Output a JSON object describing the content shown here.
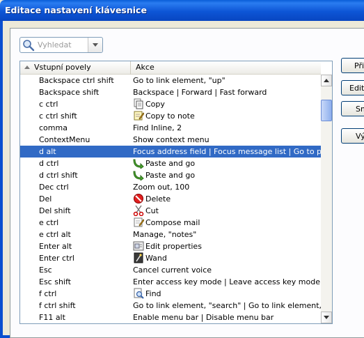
{
  "window": {
    "title": "Editace nastavení klávesnice"
  },
  "search": {
    "placeholder": "Vyhledat"
  },
  "table": {
    "columns": [
      "Vstupní povely",
      "Akce"
    ],
    "rows": [
      {
        "keys": "Backspace ctrl shift",
        "action": "Go to link element, \"up\"",
        "icon": ""
      },
      {
        "keys": "Backspace shift",
        "action": "Backspace | Forward | Fast forward",
        "icon": ""
      },
      {
        "keys": "c ctrl",
        "action": "Copy",
        "icon": "copy-icon"
      },
      {
        "keys": "c ctrl shift",
        "action": "Copy to note",
        "icon": "note-icon"
      },
      {
        "keys": "comma",
        "action": "Find Inline, 2",
        "icon": ""
      },
      {
        "keys": "ContextMenu",
        "action": "Show context menu",
        "icon": ""
      },
      {
        "keys": "d alt",
        "action": "Focus address field | Focus message list | Go to page",
        "icon": "",
        "selected": true
      },
      {
        "keys": "d ctrl",
        "action": "Paste and go",
        "icon": "paste-go-icon"
      },
      {
        "keys": "d ctrl shift",
        "action": "Paste and go",
        "icon": "paste-go-icon"
      },
      {
        "keys": "Dec ctrl",
        "action": "Zoom out, 100",
        "icon": ""
      },
      {
        "keys": "Del",
        "action": "Delete",
        "icon": "delete-icon"
      },
      {
        "keys": "Del shift",
        "action": "Cut",
        "icon": "scissors-icon"
      },
      {
        "keys": "e ctrl",
        "action": "Compose mail",
        "icon": "compose-icon"
      },
      {
        "keys": "e ctrl alt",
        "action": "Manage, \"notes\"",
        "icon": ""
      },
      {
        "keys": "Enter alt",
        "action": "Edit properties",
        "icon": "properties-icon"
      },
      {
        "keys": "Enter ctrl",
        "action": "Wand",
        "icon": "wand-icon"
      },
      {
        "keys": "Esc",
        "action": "Cancel current voice",
        "icon": ""
      },
      {
        "keys": "Esc shift",
        "action": "Enter access key mode | Leave access key mode",
        "icon": ""
      },
      {
        "keys": "f ctrl",
        "action": "Find",
        "icon": "find-icon"
      },
      {
        "keys": "f ctrl shift",
        "action": "Go to link element, \"search\" | Go to link element, \"find\"",
        "icon": ""
      },
      {
        "keys": "F11 alt",
        "action": "Enable menu bar | Disable menu bar",
        "icon": ""
      }
    ]
  },
  "buttons": [
    "Přid",
    "Edito",
    "Sm",
    "Vý"
  ]
}
